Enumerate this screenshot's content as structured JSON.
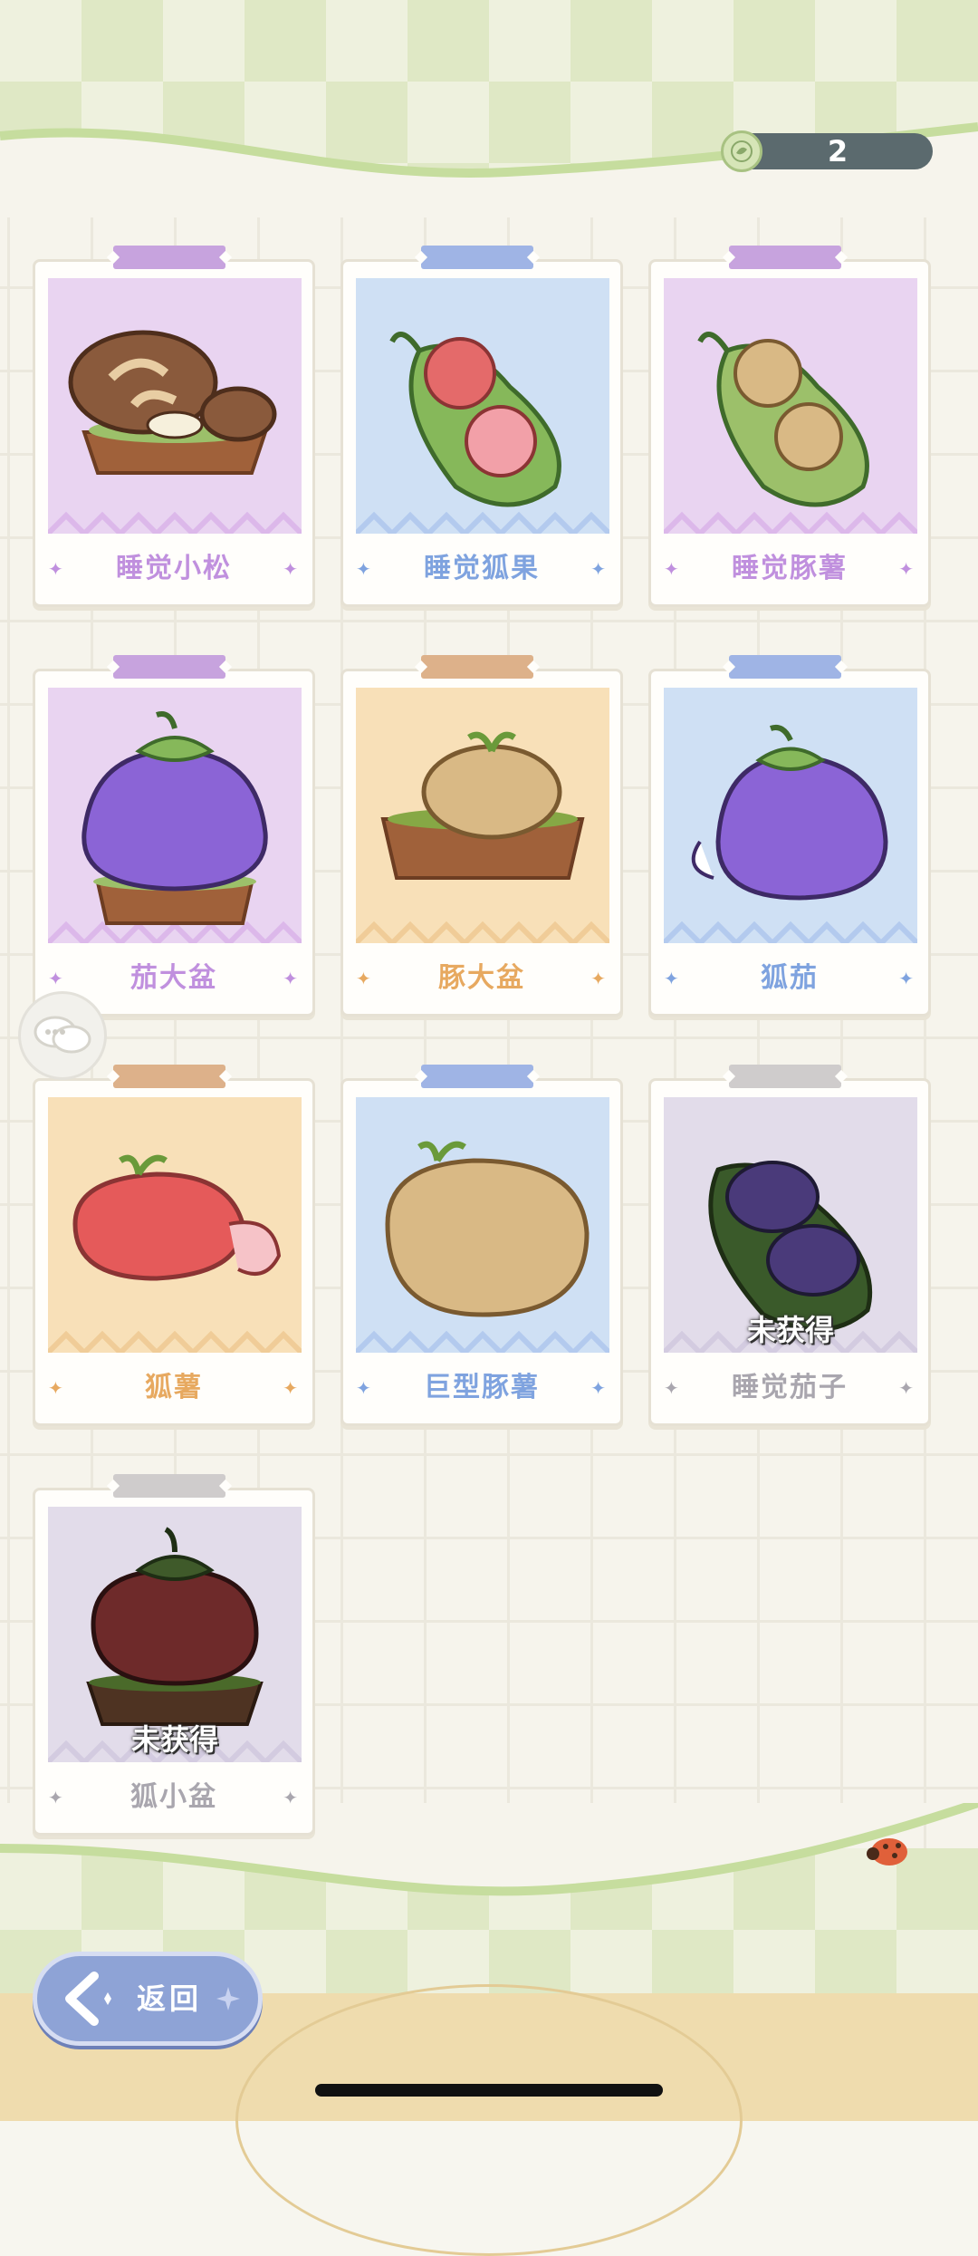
{
  "currency": {
    "value": "2",
    "icon": "leaf-coin-icon"
  },
  "cards": [
    {
      "name": "睡觉小松",
      "theme": "purple",
      "art": "sleeping-pinecone-pot",
      "locked": false
    },
    {
      "name": "睡觉狐果",
      "theme": "blue",
      "art": "sleeping-fox-fruit-pod",
      "locked": false
    },
    {
      "name": "睡觉豚薯",
      "theme": "purple",
      "art": "sleeping-capybara-potato-pod",
      "locked": false
    },
    {
      "name": "茄大盆",
      "theme": "purple",
      "art": "big-eggplant-pot",
      "locked": false
    },
    {
      "name": "豚大盆",
      "theme": "orange",
      "art": "big-capybara-pot",
      "locked": false
    },
    {
      "name": "狐茄",
      "theme": "blue",
      "art": "fox-eggplant",
      "locked": false
    },
    {
      "name": "狐薯",
      "theme": "orange",
      "art": "fox-sweet-potato",
      "locked": false
    },
    {
      "name": "巨型豚薯",
      "theme": "blue",
      "art": "giant-capybara-potato",
      "locked": false
    },
    {
      "name": "睡觉茄子",
      "theme": "gray",
      "art": "sleeping-eggplant-pod",
      "locked": true
    },
    {
      "name": "狐小盆",
      "theme": "gray",
      "art": "small-fox-pot",
      "locked": true
    }
  ],
  "locked_label": "未获得",
  "back_button": {
    "label": "返回",
    "icon": "back-arrow-icon"
  },
  "chat_button": {
    "icon": "chat-bubbles-icon"
  },
  "colors": {
    "purple_bg": "#e9d4f1",
    "blue_bg": "#cfe0f4",
    "orange_bg": "#f8e0b8",
    "gray_bg": "#e2dcea",
    "back_button": "#8ea3d6"
  }
}
